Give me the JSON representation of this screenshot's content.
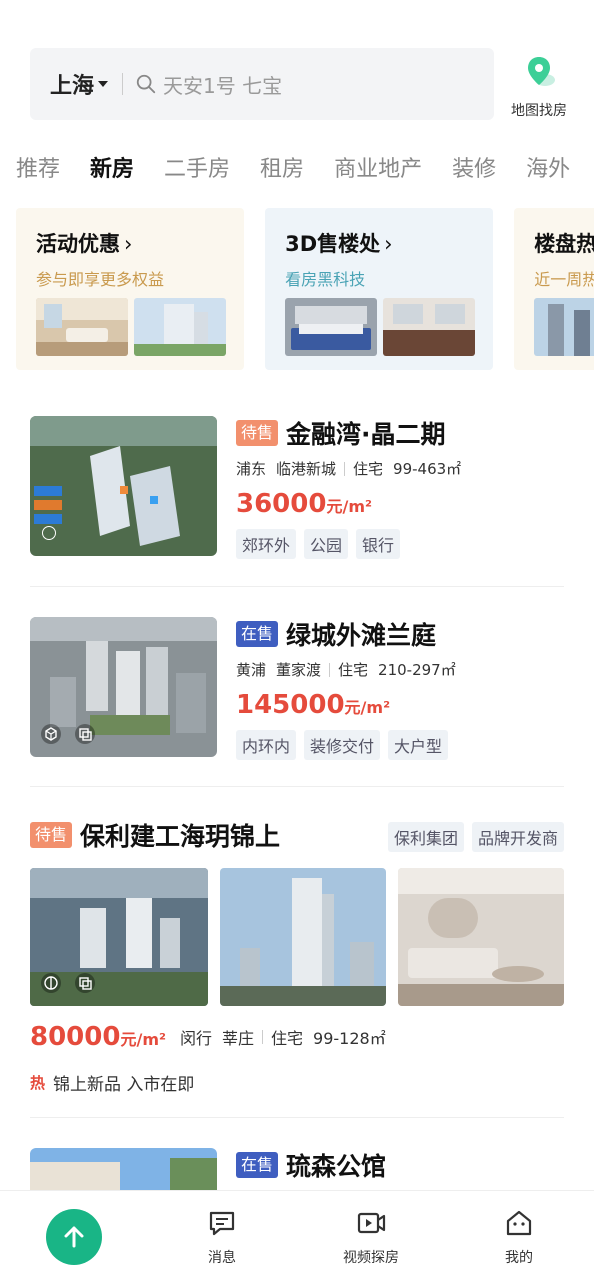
{
  "header": {
    "city": "上海",
    "search_placeholder": "天安1号 七宝",
    "map_label": "地图找房"
  },
  "tabs": [
    {
      "label": "推荐",
      "active": false
    },
    {
      "label": "新房",
      "active": true
    },
    {
      "label": "二手房",
      "active": false
    },
    {
      "label": "租房",
      "active": false
    },
    {
      "label": "商业地产",
      "active": false
    },
    {
      "label": "装修",
      "active": false
    },
    {
      "label": "海外",
      "active": false
    }
  ],
  "promos": [
    {
      "title": "活动优惠",
      "chevron": "›",
      "subtitle": "参与即享更多权益"
    },
    {
      "title": "3D售楼处",
      "chevron": "›",
      "subtitle": "看房黑科技"
    },
    {
      "title": "楼盘热",
      "chevron": "",
      "subtitle": "近一周热"
    }
  ],
  "listings": [
    {
      "status": "待售",
      "title": "金融湾·晶二期",
      "district": "浦东",
      "area": "临港新城",
      "type": "住宅",
      "size": "99-463㎡",
      "price": "36000",
      "unit": "元/m²",
      "tags": [
        "郊环外",
        "公园",
        "银行"
      ]
    },
    {
      "status": "在售",
      "title": "绿城外滩兰庭",
      "district": "黄浦",
      "area": "董家渡",
      "type": "住宅",
      "size": "210-297㎡",
      "price": "145000",
      "unit": "元/m²",
      "tags": [
        "内环内",
        "装修交付",
        "大户型"
      ]
    }
  ],
  "featured": {
    "status": "待售",
    "title": "保利建工海玥锦上",
    "tags": [
      "保利集团",
      "品牌开发商"
    ],
    "price": "80000",
    "unit": "元/m²",
    "district": "闵行",
    "area": "莘庄",
    "type": "住宅",
    "size": "99-128㎡",
    "hot_label": "热",
    "hot_text": "锦上新品 入市在即"
  },
  "partial_listing": {
    "status": "在售",
    "title": "琉森公馆"
  },
  "bottom_nav": {
    "messages": "消息",
    "video": "视频探房",
    "mine": "我的"
  },
  "colors": {
    "accent_green": "#19b586",
    "price_red": "#e54b3c",
    "badge_pending": "#f2906d",
    "badge_onsale": "#3f5ec0"
  }
}
